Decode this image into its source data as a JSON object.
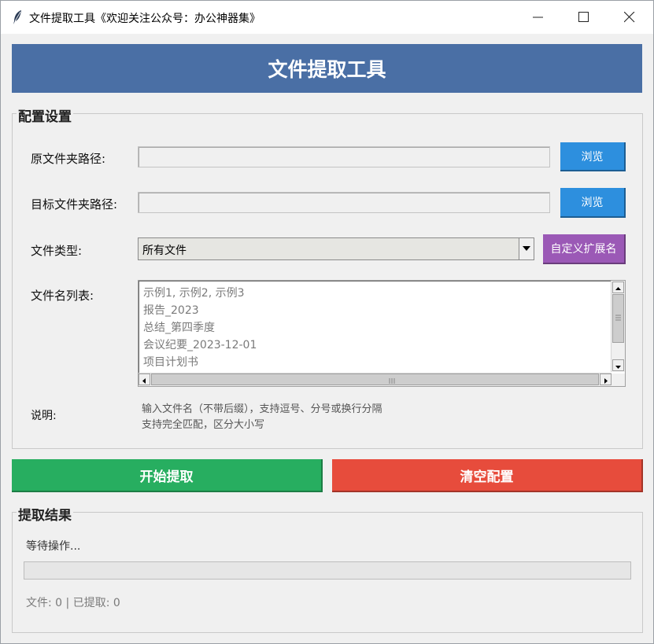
{
  "window": {
    "title": "文件提取工具《欢迎关注公众号：办公神器集》",
    "app_icon": "feather-icon",
    "controls": [
      "minimize-icon",
      "maximize-icon",
      "close-icon"
    ]
  },
  "header": {
    "title": "文件提取工具",
    "color": "#4a6fa5"
  },
  "config": {
    "legend": "配置设置",
    "source_label": "原文件夹路径:",
    "source_value": "",
    "target_label": "目标文件夹路径:",
    "target_value": "",
    "browse_label": "浏览",
    "browse_color": "#2d8fde",
    "type_label": "文件类型:",
    "type_selected": "所有文件",
    "custom_ext_label": "自定义扩展名",
    "custom_ext_color": "#9b59b6",
    "names_label": "文件名列表:",
    "names_lines": [
      "示例1, 示例2, 示例3",
      "报告_2023",
      "总结_第四季度",
      "会议纪要_2023-12-01",
      "项目计划书"
    ],
    "note_label": "说明:",
    "note_lines": [
      "输入文件名（不带后缀），支持逗号、分号或换行分隔",
      "支持完全匹配，区分大小写"
    ]
  },
  "actions": {
    "start_label": "开始提取",
    "start_color": "#27ae60",
    "clear_label": "清空配置",
    "clear_color": "#e74c3c"
  },
  "result": {
    "legend": "提取结果",
    "status": "等待操作...",
    "progress": 0,
    "stats": "文件: 0 | 已提取: 0"
  }
}
